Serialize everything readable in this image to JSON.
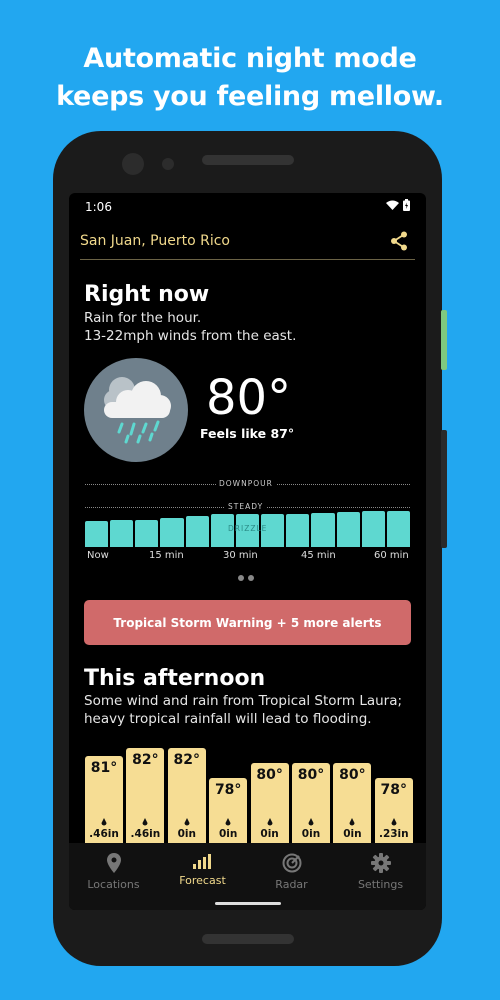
{
  "promo": {
    "line1": "Automatic night mode",
    "line2": "keeps you feeling mellow."
  },
  "status_bar": {
    "time": "1:06"
  },
  "header": {
    "location": "San Juan, Puerto Rico"
  },
  "right_now": {
    "title": "Right now",
    "line1": "Rain for the hour.",
    "line2": "13-22mph winds from the east.",
    "temperature": "80°",
    "feels_like": "Feels like 87°"
  },
  "precip_chart": {
    "levels": [
      "DOWNPOUR",
      "STEADY",
      "DRIZZLE"
    ],
    "ticks": [
      "Now",
      "15 min",
      "30 min",
      "45 min",
      "60 min"
    ],
    "bar_fraction": [
      0.68,
      0.7,
      0.72,
      0.76,
      0.82,
      0.86,
      0.86,
      0.88,
      0.88,
      0.9,
      0.92,
      0.95,
      0.95
    ]
  },
  "alert": {
    "label": "Tropical Storm Warning + 5 more alerts"
  },
  "afternoon": {
    "title": "This afternoon",
    "line1": "Some wind and rain from Tropical Storm Laura;",
    "line2": "heavy tropical rainfall will lead to flooding.",
    "hours": [
      {
        "temp": "81°",
        "rain": ".46in"
      },
      {
        "temp": "82°",
        "rain": ".46in"
      },
      {
        "temp": "82°",
        "rain": "0in"
      },
      {
        "temp": "78°",
        "rain": "0in"
      },
      {
        "temp": "80°",
        "rain": "0in"
      },
      {
        "temp": "80°",
        "rain": "0in"
      },
      {
        "temp": "80°",
        "rain": "0in"
      },
      {
        "temp": "78°",
        "rain": ".23in"
      }
    ]
  },
  "nav": [
    {
      "label": "Locations"
    },
    {
      "label": "Forecast"
    },
    {
      "label": "Radar"
    },
    {
      "label": "Settings"
    }
  ],
  "colors": {
    "background": "#22a7f0",
    "accent": "#f1d98c",
    "precip_bar": "#5ed8d0",
    "alert": "#d06a6a",
    "hour_bar": "#f6dd94"
  }
}
